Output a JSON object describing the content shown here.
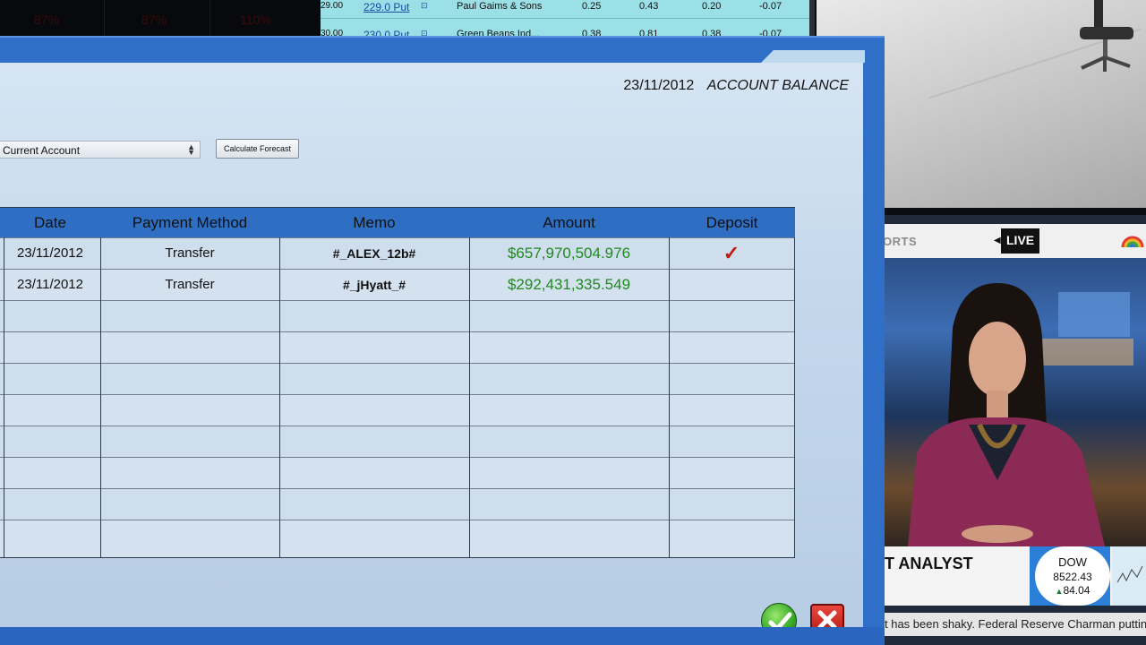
{
  "background": {
    "stats": [
      "87%",
      "87%",
      "110%"
    ],
    "options_table": {
      "rows": [
        {
          "strike": "29.00",
          "option": "229.0 Put",
          "company": "Paul Gaims & Sons",
          "v1": "0.25",
          "v2": "0.43",
          "v3": "0.20",
          "v4": "-0.07"
        },
        {
          "strike": "30.00",
          "option": "230.0 Put",
          "company": "Green Beans Ind...",
          "v1": "0.38",
          "v2": "0.81",
          "v3": "0.38",
          "v4": "-0.07"
        }
      ]
    },
    "news": {
      "section": "ORTS",
      "live_label": "LIVE",
      "headline": "T ANALYST",
      "index": {
        "name": "DOW",
        "value": "8522.43",
        "change": "84.04"
      },
      "ticker": "t has been shaky. Federal Reserve Charman putting more"
    }
  },
  "dialog": {
    "date": "23/11/2012",
    "title": "ACCOUNT BALANCE",
    "account_select": {
      "value": "Current Account"
    },
    "forecast_button": "Calculate Forecast",
    "table": {
      "headers": [
        "Date",
        "Payment Method",
        "Memo",
        "Amount",
        "Deposit"
      ],
      "rows": [
        {
          "date": "23/11/2012",
          "method": "Transfer",
          "memo": "#_ALEX_12b#",
          "amount": "$657,970,504.976",
          "deposit": "✓"
        },
        {
          "date": "23/11/2012",
          "method": "Transfer",
          "memo": "#_jHyatt_#",
          "amount": "$292,431,335.549",
          "deposit": ""
        }
      ]
    }
  },
  "colors": {
    "dialog_frame": "#2f6fc8",
    "header_bar": "#2e6fc3",
    "amount_green": "#1f8a1f",
    "deposit_check": "#c21a12"
  },
  "icons": {
    "ok": "check-circle-icon",
    "cancel": "close-x-icon",
    "deposit": "checkmark-icon",
    "select": "updown-arrows-icon"
  }
}
